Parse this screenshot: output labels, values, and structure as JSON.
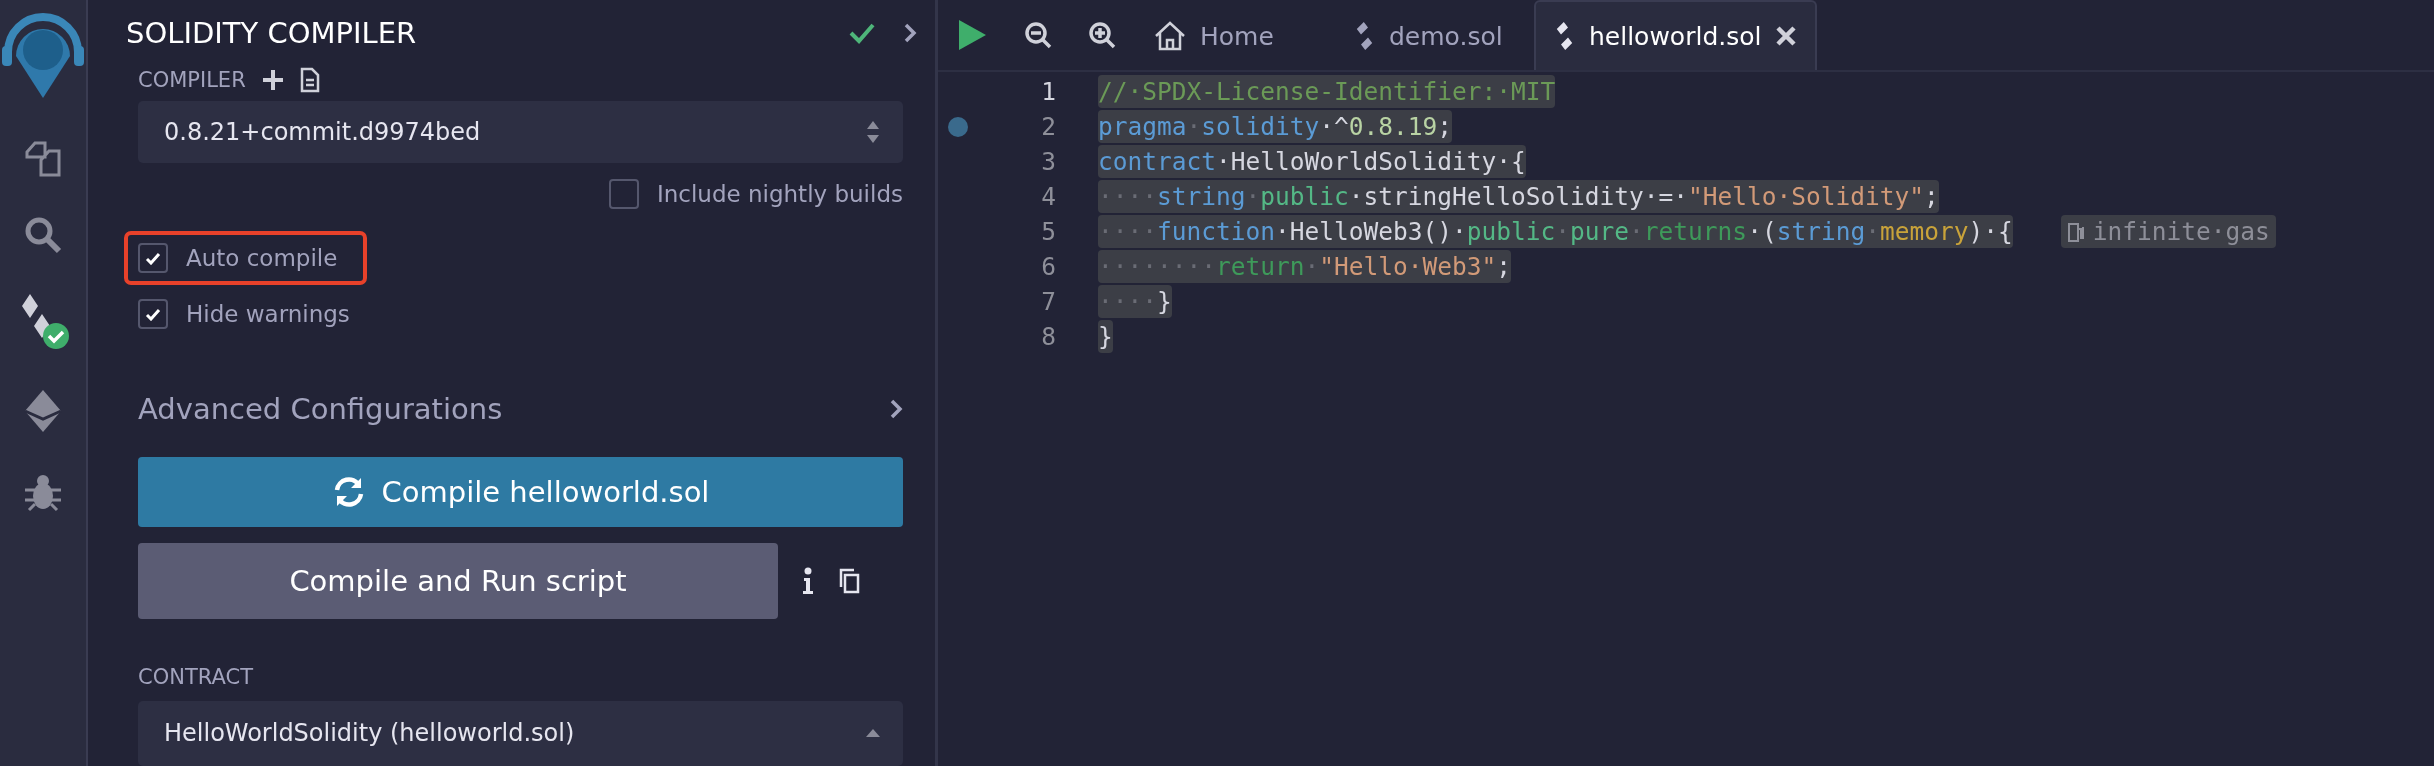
{
  "panel": {
    "title": "SOLIDITY COMPILER",
    "compiler_label": "COMPILER",
    "compiler_version": "0.8.21+commit.d9974bed",
    "options": [
      {
        "label": "Include nightly builds",
        "checked": false,
        "highlighted": false
      },
      {
        "label": "Auto compile",
        "checked": true,
        "highlighted": true
      },
      {
        "label": "Hide warnings",
        "checked": true,
        "highlighted": false
      }
    ],
    "advanced": "Advanced Configurations",
    "compile_button": "Compile helloworld.sol",
    "run_button": "Compile and Run script",
    "contract_label": "CONTRACT",
    "contract_value": "HelloWorldSolidity (helloworld.sol)"
  },
  "editor": {
    "tabs": [
      {
        "label": "Home",
        "kind": "home",
        "selected": false
      },
      {
        "label": "demo.sol",
        "kind": "file",
        "selected": false
      },
      {
        "label": "helloworld.sol",
        "kind": "file",
        "selected": true
      }
    ],
    "lines": [
      {
        "number": "1",
        "breakpoint": false,
        "tokens": [
          {
            "t": "//·SPDX-License-Identifier:·MIT",
            "color": "#6b9a57"
          }
        ]
      },
      {
        "number": "2",
        "breakpoint": true,
        "tokens": [
          {
            "t": "pragma",
            "color": "#5b9bd5"
          },
          {
            "t": "·",
            "color": "#6a6c75"
          },
          {
            "t": "solidity",
            "color": "#5b9bd5"
          },
          {
            "t": "·^",
            "color": "#d6d7e0"
          },
          {
            "t": "0.8.19",
            "color": "#b9d3a4"
          },
          {
            "t": ";",
            "color": "#d6d7e0"
          }
        ]
      },
      {
        "number": "3",
        "breakpoint": false,
        "tokens": [
          {
            "t": "contract",
            "color": "#5b9bd5"
          },
          {
            "t": "·HelloWorldSolidity·{",
            "color": "#d6d7e0"
          }
        ]
      },
      {
        "number": "4",
        "breakpoint": false,
        "tokens": [
          {
            "t": "····",
            "color": "#6a6c75"
          },
          {
            "t": "string",
            "color": "#5b9bd5"
          },
          {
            "t": "·",
            "color": "#6a6c75"
          },
          {
            "t": "public",
            "color": "#54b886"
          },
          {
            "t": "·stringHelloSolidity·=·",
            "color": "#d6d7e0"
          },
          {
            "t": "\"Hello·Solidity\"",
            "color": "#d29a78"
          },
          {
            "t": ";",
            "color": "#d6d7e0"
          }
        ]
      },
      {
        "number": "5",
        "breakpoint": false,
        "tokens": [
          {
            "t": "····",
            "color": "#6a6c75"
          },
          {
            "t": "function",
            "color": "#5b9bd5"
          },
          {
            "t": "·HelloWeb3()·",
            "color": "#d6d7e0"
          },
          {
            "t": "public",
            "color": "#54b886"
          },
          {
            "t": "·",
            "color": "#6a6c75"
          },
          {
            "t": "pure",
            "color": "#54b886"
          },
          {
            "t": "·",
            "color": "#6a6c75"
          },
          {
            "t": "returns",
            "color": "#3e9a5a"
          },
          {
            "t": "·(",
            "color": "#d6d7e0"
          },
          {
            "t": "string",
            "color": "#5b9bd5"
          },
          {
            "t": "·",
            "color": "#6a6c75"
          },
          {
            "t": "memory",
            "color": "#c9a33a"
          },
          {
            "t": ")·{",
            "color": "#d6d7e0"
          }
        ],
        "hint": "infinite·gas"
      },
      {
        "number": "6",
        "breakpoint": false,
        "tokens": [
          {
            "t": "········",
            "color": "#6a6c75"
          },
          {
            "t": "return",
            "color": "#3e9a5a"
          },
          {
            "t": "·",
            "color": "#6a6c75"
          },
          {
            "t": "\"Hello·Web3\"",
            "color": "#d29a78"
          },
          {
            "t": ";",
            "color": "#d6d7e0"
          }
        ]
      },
      {
        "number": "7",
        "breakpoint": false,
        "tokens": [
          {
            "t": "····",
            "color": "#6a6c75"
          },
          {
            "t": "}",
            "color": "#d6d7e0"
          }
        ]
      },
      {
        "number": "8",
        "breakpoint": false,
        "tokens": [
          {
            "t": "}",
            "color": "#d6d7e0"
          }
        ]
      }
    ]
  }
}
